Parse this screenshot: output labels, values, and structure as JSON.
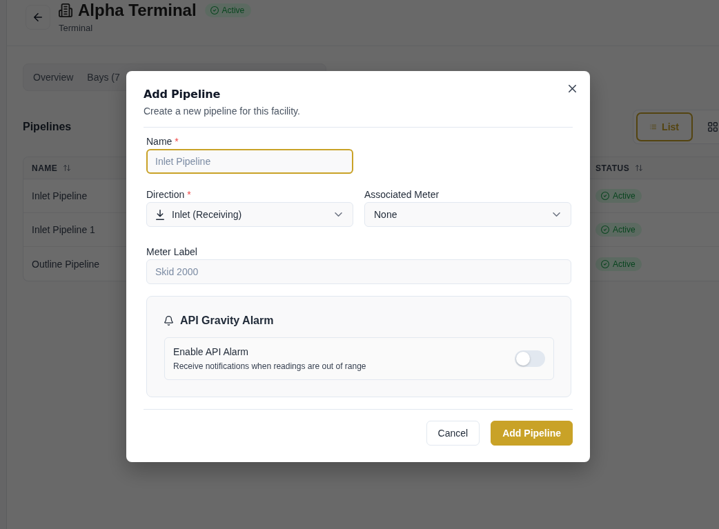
{
  "page": {
    "header": {
      "title": "Alpha Terminal",
      "status": "Active",
      "subtitle": "Terminal"
    },
    "tabs": [
      {
        "label": "Overview",
        "selected": false
      },
      {
        "label": "Bays (7",
        "selected": false
      }
    ],
    "section_title": "Pipelines",
    "view_options": [
      {
        "kind": "list",
        "label": "List",
        "selected": true
      },
      {
        "kind": "grid",
        "selected": false
      }
    ],
    "table": {
      "columns": [
        {
          "label": "NAME"
        },
        {
          "label": "STATUS"
        }
      ],
      "rows": [
        {
          "name": "Inlet Pipeline",
          "status": "Active"
        },
        {
          "name": "Inlet Pipeline 1",
          "status": "Active"
        },
        {
          "name": "Outline Pipeline",
          "status": "Active"
        }
      ]
    }
  },
  "dialog": {
    "title": "Add Pipeline",
    "description": "Create a new pipeline for this facility.",
    "name_field": {
      "label": "Name",
      "required_mark": "*",
      "placeholder": "Inlet Pipeline",
      "focused": true
    },
    "direction_field": {
      "label": "Direction",
      "required_mark": "*",
      "value": "Inlet (Receiving)"
    },
    "meter_field": {
      "label": "Associated Meter",
      "value": "None"
    },
    "meter_label_field": {
      "label": "Meter Label",
      "placeholder": "Skid 2000"
    },
    "alarm": {
      "title": "API Gravity Alarm",
      "setting": {
        "label": "Enable API Alarm",
        "description": "Receive notifications when readings are out of range",
        "on": false
      }
    },
    "buttons": [
      {
        "label": "Cancel",
        "kind": "secondary"
      },
      {
        "label": "Add Pipeline",
        "kind": "primary"
      }
    ]
  }
}
